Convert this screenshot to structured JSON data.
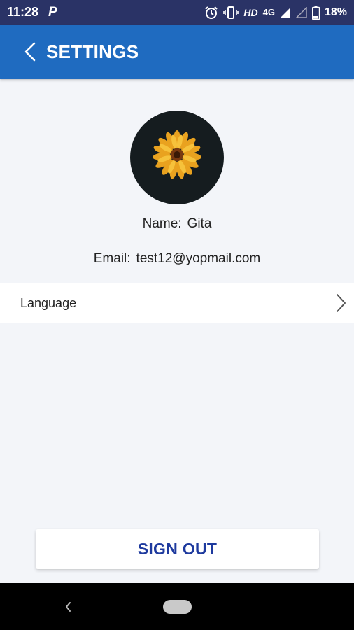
{
  "status_bar": {
    "time": "11:28",
    "app_indicator": "P",
    "network_hd": "HD",
    "network_type": "4G",
    "battery": "18%",
    "icons": [
      "alarm-icon",
      "vibrate-icon",
      "signal-icon",
      "signal-empty-icon",
      "battery-icon"
    ]
  },
  "header": {
    "title": "SETTINGS",
    "back_icon": "chevron-left-icon"
  },
  "profile": {
    "avatar_icon": "sunflower-photo",
    "name_label": "Name:",
    "name_value": "Gita",
    "email_label": "Email:",
    "email_value": "test12@yopmail.com"
  },
  "menu": {
    "items": [
      {
        "label": "Language",
        "icon": "chevron-right-icon"
      }
    ]
  },
  "actions": {
    "sign_out_label": "SIGN OUT"
  },
  "colors": {
    "status_bar": "#2a3366",
    "app_bar": "#1f6bc0",
    "background": "#f3f5f9",
    "sign_out_text": "#1e3a9e"
  }
}
